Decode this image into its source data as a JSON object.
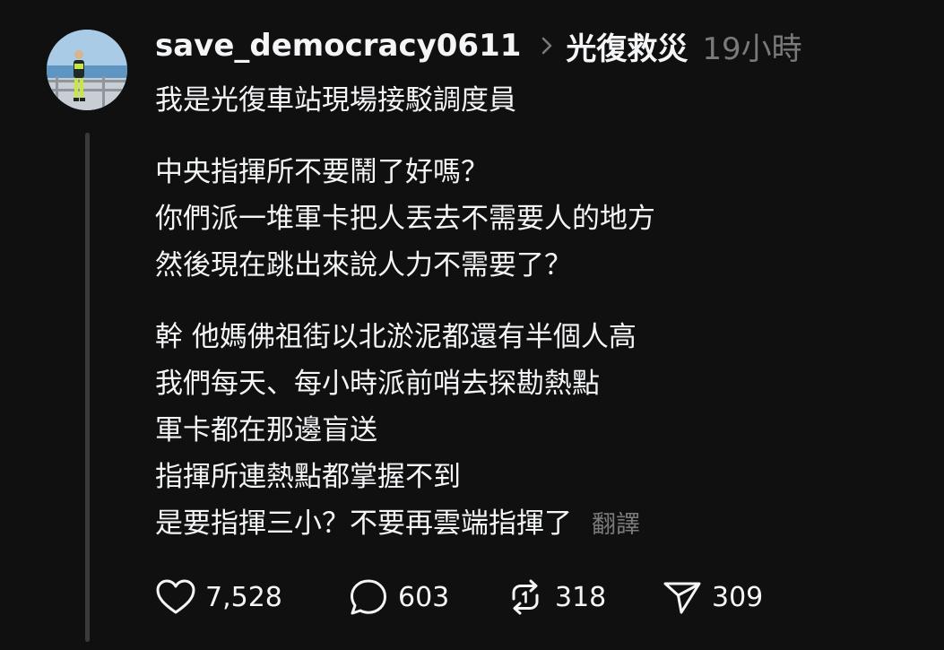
{
  "post": {
    "username": "save_democracy0611",
    "community": "光復救災",
    "time": "19小時",
    "paragraphs": [
      [
        "我是光復車站現場接駁調度員"
      ],
      [
        "中央指揮所不要鬧了好嗎？",
        "你們派一堆軍卡把人丟去不需要人的地方",
        "然後現在跳出來說人力不需要了？"
      ],
      [
        "幹 他媽佛祖街以北淤泥都還有半個人高",
        "我們每天、每小時派前哨去探勘熱點",
        "軍卡都在那邊盲送",
        "指揮所連熱點都掌握不到",
        "是要指揮三小？不要再雲端指揮了"
      ]
    ],
    "translate_label": "翻譯"
  },
  "actions": {
    "likes": "7,528",
    "replies": "603",
    "reposts": "318",
    "shares": "309"
  },
  "icons": {
    "like": "heart-icon",
    "reply": "comment-bubble-icon",
    "repost": "repost-icon",
    "share": "send-icon",
    "chevron": "chevron-right-icon"
  },
  "colors": {
    "background": "#101010",
    "text": "#f3f5f7",
    "muted": "#7a7a7a",
    "thread_line": "#3a3a3a"
  }
}
